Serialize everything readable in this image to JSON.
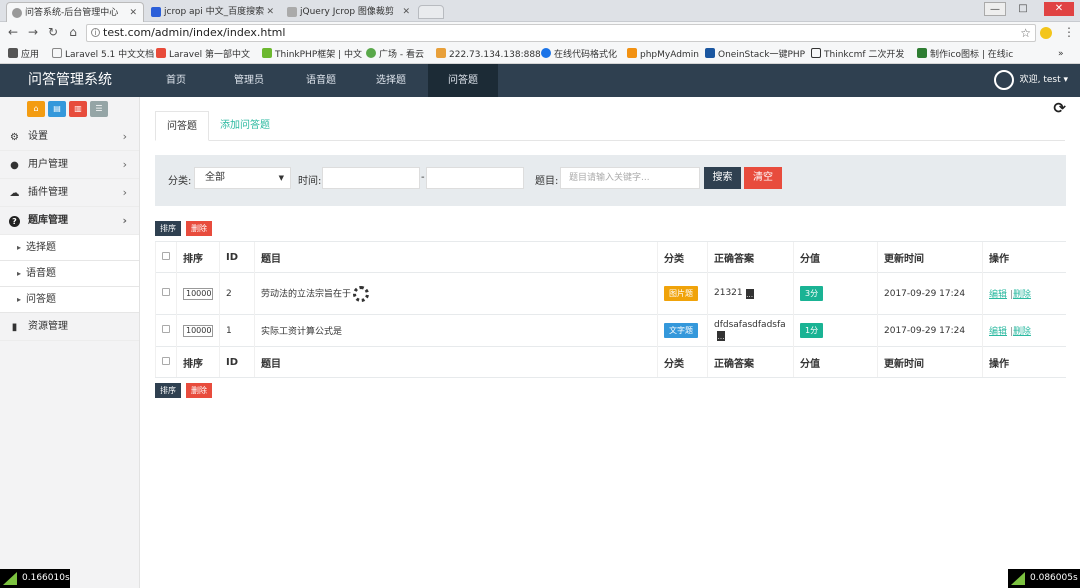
{
  "browser": {
    "tabs": [
      {
        "title": "问答系统-后台管理中心",
        "active": true
      },
      {
        "title": "jcrop api 中文_百度搜索",
        "active": false
      },
      {
        "title": "jQuery Jcrop 图像裁剪",
        "active": false
      }
    ],
    "url": "test.com/admin/index/index.html",
    "bookmarks": [
      "应用",
      "Laravel 5.1 中文文档",
      "Laravel 第一部中文",
      "ThinkPHP框架 | 中文",
      "广场 - 看云",
      "222.73.134.138:888",
      "在线代码格式化",
      "phpMyAdmin",
      "OneinStack一键PHP",
      "Thinkcmf 二次开发",
      "制作ico图标 | 在线ic"
    ],
    "bookmarks_more": "»"
  },
  "header": {
    "brand": "问答管理系统",
    "menu": [
      "首页",
      "管理员",
      "语音题",
      "选择题",
      "问答题"
    ],
    "active_menu": "问答题",
    "user": "欢迎, test"
  },
  "sidebar": {
    "items": [
      {
        "label": "设置",
        "icon": "gear-icon"
      },
      {
        "label": "用户管理",
        "icon": "users-icon"
      },
      {
        "label": "插件管理",
        "icon": "cloud-icon"
      },
      {
        "label": "题库管理",
        "icon": "question-icon"
      }
    ],
    "subitems": [
      "选择题",
      "语音题",
      "问答题"
    ],
    "resource": "资源管理"
  },
  "content": {
    "tabs": [
      "问答题",
      "添加问答题"
    ],
    "filter": {
      "category_label": "分类:",
      "category_value": "全部",
      "time_label": "时间:",
      "time_sep": "-",
      "question_label": "题目:",
      "question_placeholder": "题目请输入关键字...",
      "search_btn": "搜索",
      "clear_btn": "清空"
    },
    "sort_btn": "排序",
    "delete_btn": "删除",
    "table": {
      "headers": [
        "排序",
        "ID",
        "题目",
        "分类",
        "正确答案",
        "分值",
        "更新时间",
        "操作"
      ],
      "rows": [
        {
          "sort": "10000",
          "id": "2",
          "title": "劳动法的立法宗旨在于",
          "category": "图片题",
          "category_color": "#f0a30a",
          "answer": "21321",
          "score": "3分",
          "updated": "2017-09-29 17:24",
          "edit": "编辑",
          "del": "删除"
        },
        {
          "sort": "10000",
          "id": "1",
          "title": "实际工资计算公式是",
          "category": "文字题",
          "category_color": "#3498db",
          "answer": "dfdsafasdfadsfa",
          "score": "1分",
          "updated": "2017-09-29 17:24",
          "edit": "编辑",
          "del": "删除"
        }
      ]
    },
    "op_sep": "|"
  },
  "debug": {
    "left": "0.166010s",
    "right": "0.086005s"
  }
}
